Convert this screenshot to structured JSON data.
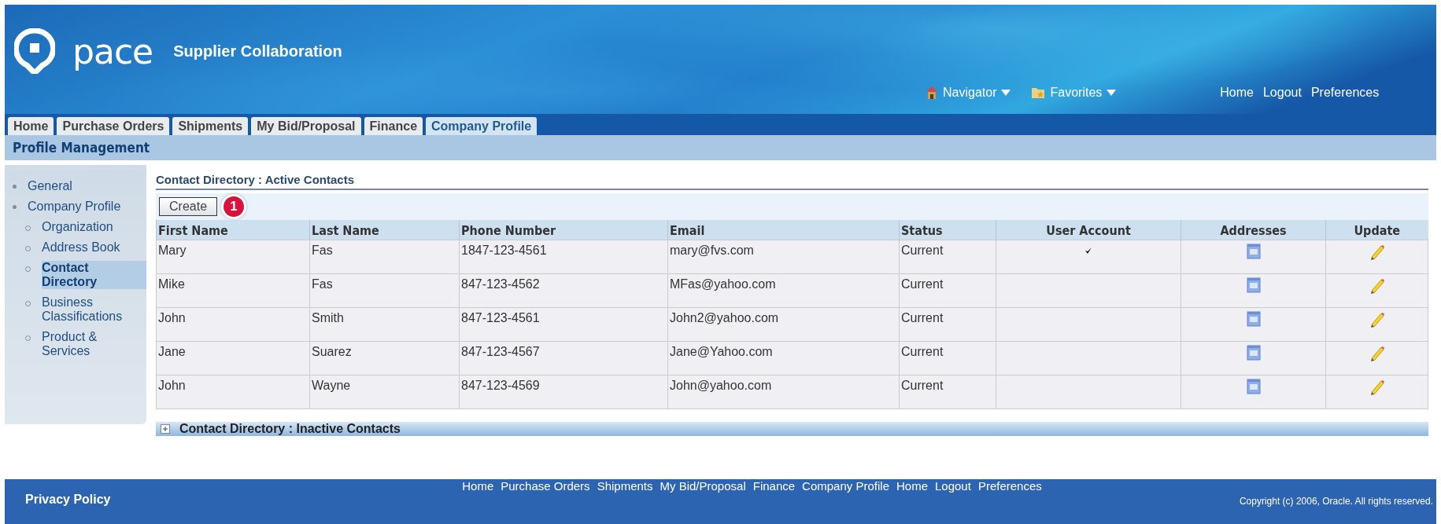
{
  "header": {
    "logo": "pace",
    "title": "Supplier Collaboration",
    "menus": [
      {
        "label": "Navigator",
        "kind": "home"
      },
      {
        "label": "Favorites",
        "kind": "favorites"
      }
    ],
    "links": [
      "Home",
      "Logout",
      "Preferences"
    ]
  },
  "tabs": [
    {
      "label": "Home",
      "selected": false
    },
    {
      "label": "Purchase Orders",
      "selected": false
    },
    {
      "label": "Shipments",
      "selected": false
    },
    {
      "label": "My Bid/Proposal",
      "selected": false
    },
    {
      "label": "Finance",
      "selected": false
    },
    {
      "label": "Company Profile",
      "selected": true
    }
  ],
  "subheader": "Profile Management",
  "sidebar": {
    "items": [
      {
        "label": "General",
        "selected": false
      },
      {
        "label": "Company Profile",
        "selected": false,
        "children": [
          {
            "label": "Organization",
            "selected": false
          },
          {
            "label": "Address Book",
            "selected": false
          },
          {
            "label": "Contact Directory",
            "selected": true
          },
          {
            "label": "Business Classifications",
            "selected": false
          },
          {
            "label": "Product & Services",
            "selected": false
          }
        ]
      }
    ]
  },
  "section_title": "Contact Directory : Active Contacts",
  "create_button": "Create",
  "callout": "1",
  "table": {
    "columns": [
      "First Name",
      "Last Name",
      "Phone Number",
      "Email",
      "Status",
      "User Account",
      "Addresses",
      "Update"
    ],
    "rows": [
      {
        "first": "Mary",
        "last": "Fas",
        "phone": "1847-123-4561",
        "email": "mary@fvs.com",
        "status": "Current",
        "user_account": true
      },
      {
        "first": "Mike",
        "last": "Fas",
        "phone": "847-123-4562",
        "email": "MFas@yahoo.com",
        "status": "Current",
        "user_account": false
      },
      {
        "first": "John",
        "last": "Smith",
        "phone": "847-123-4561",
        "email": "John2@yahoo.com",
        "status": "Current",
        "user_account": false
      },
      {
        "first": "Jane",
        "last": "Suarez",
        "phone": "847-123-4567",
        "email": "Jane@Yahoo.com",
        "status": "Current",
        "user_account": false
      },
      {
        "first": "John",
        "last": "Wayne",
        "phone": "847-123-4569",
        "email": "John@yahoo.com",
        "status": "Current",
        "user_account": false
      }
    ]
  },
  "collapsed_section": {
    "label": "Contact Directory : Inactive Contacts",
    "expanded": false
  },
  "footer": {
    "links": [
      "Home",
      "Purchase Orders",
      "Shipments",
      "My Bid/Proposal",
      "Finance",
      "Company Profile",
      "Home",
      "Logout",
      "Preferences"
    ],
    "privacy": "Privacy Policy",
    "copyright": "Copyright (c) 2006, Oracle. All rights reserved."
  }
}
